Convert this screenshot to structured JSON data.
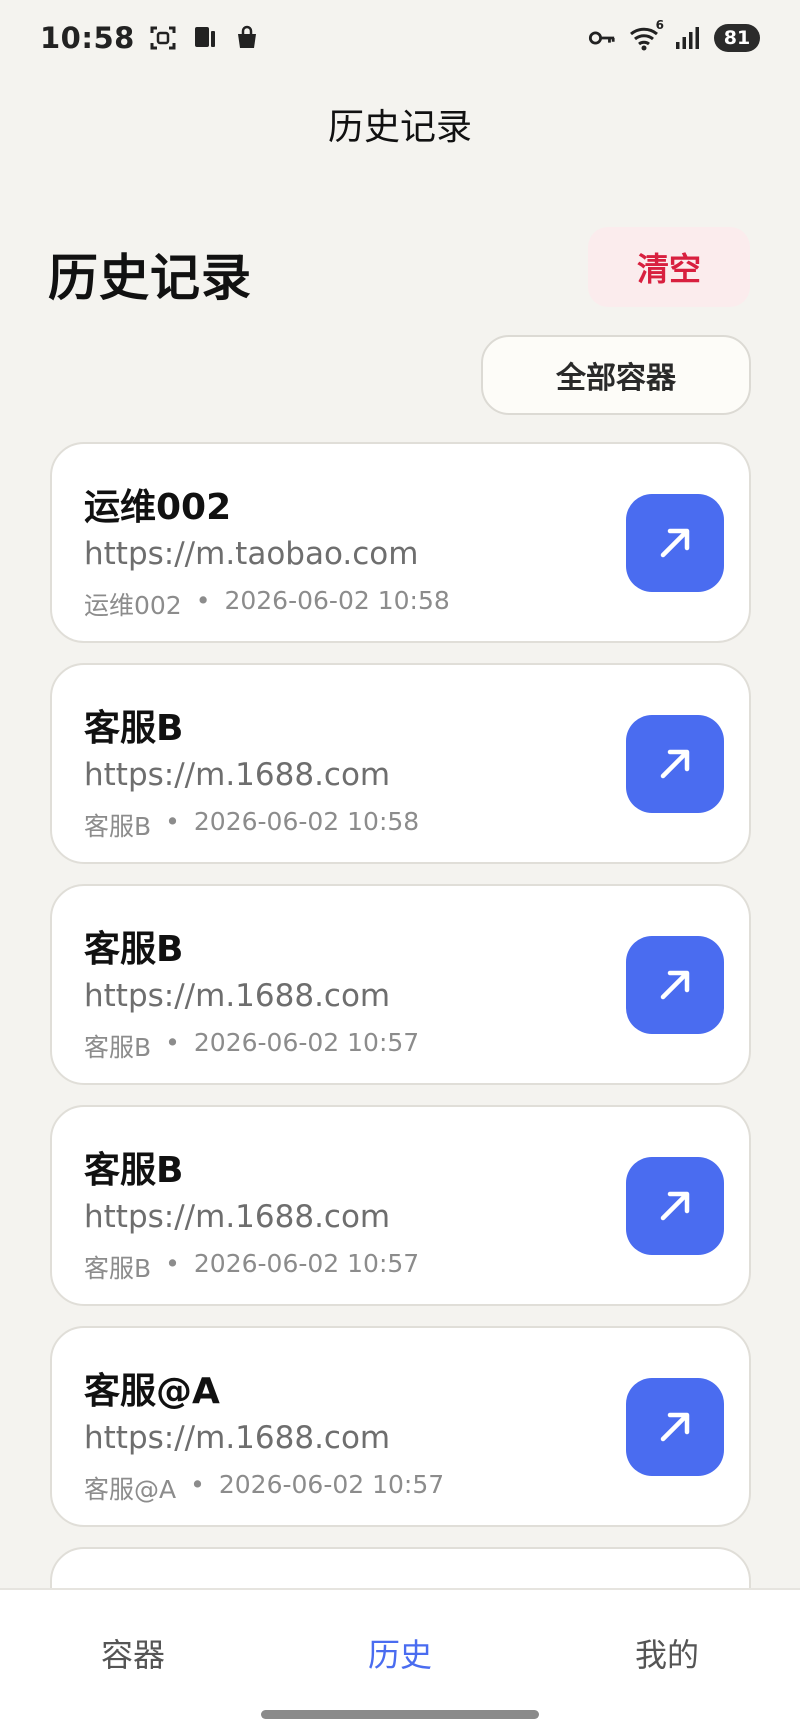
{
  "status_bar": {
    "time": "10:58",
    "left_icons": [
      "scan-icon",
      "device-icon",
      "bag-icon"
    ],
    "right_icons": [
      "key-icon",
      "wifi-icon",
      "signal-icon"
    ],
    "wifi_badge": "6",
    "battery": "81"
  },
  "app_bar": {
    "title": "历史记录"
  },
  "header": {
    "title": "历史记录",
    "clear_label": "清空",
    "filter_label": "全部容器"
  },
  "history": [
    {
      "title": "运维002",
      "url": "https://m.taobao.com",
      "container": "运维002",
      "datetime": "2026-06-02 10:58"
    },
    {
      "title": "客服B",
      "url": "https://m.1688.com",
      "container": "客服B",
      "datetime": "2026-06-02 10:58"
    },
    {
      "title": "客服B",
      "url": "https://m.1688.com",
      "container": "客服B",
      "datetime": "2026-06-02 10:57"
    },
    {
      "title": "客服B",
      "url": "https://m.1688.com",
      "container": "客服B",
      "datetime": "2026-06-02 10:57"
    },
    {
      "title": "客服@A",
      "url": "https://m.1688.com",
      "container": "客服@A",
      "datetime": "2026-06-02 10:57"
    }
  ],
  "meta_separator": "•",
  "nav": {
    "items": [
      {
        "label": "容器"
      },
      {
        "label": "历史",
        "active": true
      },
      {
        "label": "我的"
      }
    ]
  },
  "colors": {
    "background": "#f4f3ef",
    "accent": "#4a6cf0",
    "danger": "#d8203f",
    "danger_bg": "#fbeced"
  }
}
